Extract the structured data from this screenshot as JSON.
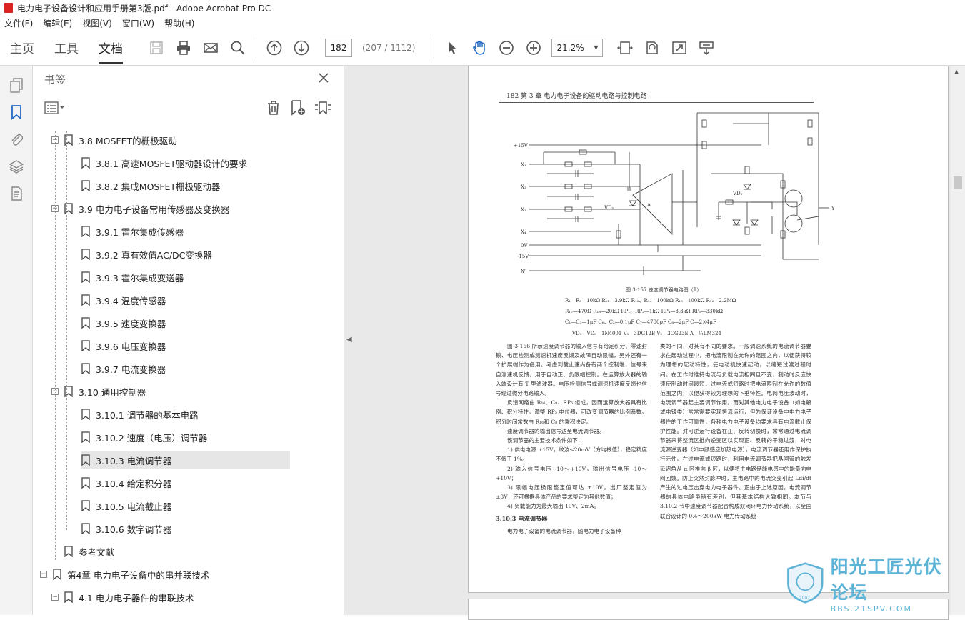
{
  "window": {
    "title": "电力电子设备设计和应用手册第3版.pdf - Adobe Acrobat Pro DC"
  },
  "menu": [
    "文件(F)",
    "编辑(E)",
    "视图(V)",
    "窗口(W)",
    "帮助(H)"
  ],
  "toolbar": {
    "tabs": [
      "主页",
      "工具",
      "文档"
    ],
    "page_number": "182",
    "page_count": "(207 / 1112)",
    "zoom": "21.2%"
  },
  "panel": {
    "title": "书签",
    "items": [
      {
        "label": "3.8  MOSFET的栅极驱动",
        "level": 1
      },
      {
        "label": "3.8.1  高速MOSFET驱动器设计的要求",
        "level": 2
      },
      {
        "label": "3.8.2  集成MOSFET栅极驱动器",
        "level": 2
      },
      {
        "label": "3.9  电力电子设备常用传感器及变换器",
        "level": 1
      },
      {
        "label": "3.9.1  霍尔集成传感器",
        "level": 2
      },
      {
        "label": "3.9.2  真有效值AC/DC变换器",
        "level": 2
      },
      {
        "label": "3.9.3  霍尔集成变送器",
        "level": 2
      },
      {
        "label": "3.9.4  温度传感器",
        "level": 2
      },
      {
        "label": "3.9.5  速度变换器",
        "level": 2
      },
      {
        "label": "3.9.6  电压变换器",
        "level": 2
      },
      {
        "label": "3.9.7  电流变换器",
        "level": 2
      },
      {
        "label": "3.10  通用控制器",
        "level": 1
      },
      {
        "label": "3.10.1  调节器的基本电路",
        "level": 2
      },
      {
        "label": "3.10.2  速度（电压）调节器",
        "level": 2
      },
      {
        "label": "3.10.3  电流调节器",
        "level": 2
      },
      {
        "label": "3.10.4  给定积分器",
        "level": 2
      },
      {
        "label": "3.10.5  电流截止器",
        "level": 2
      },
      {
        "label": "3.10.6  数字调节器",
        "level": 2
      },
      {
        "label": "参考文献",
        "level": 1
      },
      {
        "label": "第4章  电力电子设备中的串并联技术",
        "level": 0
      },
      {
        "label": "4.1  电力电子器件的串联技术",
        "level": 1
      }
    ],
    "selected_index": 14
  },
  "pdf_page": {
    "header": "182    第 3 章    电力电子设备的驱动电路与控制电路",
    "fig_caption": "图 3-157    速度调节器电路图（Ⅱ）",
    "components": [
      "R₁—R₃—10kΩ    R₁₁—3.9kΩ    R₁₃、R₁₄—100kΩ    R₁₅—100kΩ    R₁₆—2.2MΩ",
      "R₁₇—470Ω    R₁₈—20kΩ    RP₁、RP₂—1kΩ    RP₄—3.3kΩ    RP₅—330kΩ",
      "C₁—C₃—1μF    C₆、C₃—0.1μF    C₇—4700pF    C₈—2μF    C—2×4μF",
      "VD₁—VD₅—1N4001    V₁—3DG12B    V₂—3CG23E    A—¼LM324"
    ],
    "left_col": [
      "图 3-156 所示速度调节器的输入信号有给定积分、零速封锁、电压检测或测速机速度反馈及故障自动限幅，另外还有一个扩展端作为备用。考虑到截止速尚备有两个控制端，信号来自测速机反馈，用于自动正、负限幅控制。在运算放大器的输入端设计有 T 型滤波器。电压检测信号或测速机速度反馈也信号经过微分电路输入。",
      "反馈网络由 R₁₆、C₈、RP₅ 组成，因而运算放大器具有比例、积分特性。调整 RP₅ 电位器，可改变调节器的比例系数。积分时间常数由 R₁₆和 C₈ 的乘积决定。",
      "速度调节器的输出信号送至电流调节器。",
      "该调节器的主要技术条件如下：",
      "1) 供电电源 ±15V，纹波≤20mV（方均根值），稳定精度不低于 1%。",
      "2) 输入信号电压 -10～+10V，输出信号电压 -10～+10V；",
      "3) 限幅电压极限整定值可达 ±10V，出厂整定值为 ±8V，还可根据具体产品的要求整定为其他数值；",
      "4) 负载能力为最大输出 10V、2mA。"
    ],
    "section_heading": "3.10.3    电流调节器",
    "section_para": "电力电子设备的电流调节器，随电力电子设备种",
    "right_col": "类的不同，对其有不同的要求。一般调速系统的电流调节器要求在起动过程中，把电流限制在允许的范围之内，以便获得较为理想的起动特性，使电动机快速起动，以缩短过渡过程时间。在工作时维持电流与负载电流相同且不变，制动时反应快速使制动时间最短，过电流或短路时把电流限制在允许的数值范围之内，以便获得较为理想的下垂特性。电网电压波动时，电流调节器起主要调节作用。而对其他电力电子设备（如电解或电镀类）常常需要实现恒流运行，但为保证设备中电力电子器件的工作可靠性，各种电力电子设备均要求具有电流截止保护性能。对可逆运行设备在正、反转切换时，常常通过电流调节器来将整流区推向逆变区以实现正、反转的平稳过渡，对电流源逆变器（如中频感应加热电源），电流调节器还用作保护执行元件。在过电流或短路时，利用电流调节器把晶闸管的触发延迟角从 α 区推向 β 区，以便将主电路储能电感中的能量向电网回馈。防止突然封脉冲时，主电路中的电流突变引起 Ldi/dt 产生的过电压击穿电力电子器件。正由于上述原因，电流调节器的具体电路虽稍有差别，但其基本结构大致相同。本节与 3.10.2 节中速度调节器配合构成双闭环电力传动系统，以全国联合设计的 0.4～200kW 电力传动系统",
    "circuit_labels": [
      "+15V",
      "X₁",
      "X₂",
      "X₃",
      "X₄",
      "0V",
      "-15V",
      "Xᶠ",
      "Y",
      "A",
      "VD₁",
      "VD₅"
    ]
  },
  "watermark": {
    "brand": "阳光工匠光伏论坛",
    "url": "BBS.21SPV.COM",
    "year": "2007"
  },
  "colors": {
    "accent": "#2468c4",
    "watermark": "#5cb3d6"
  }
}
